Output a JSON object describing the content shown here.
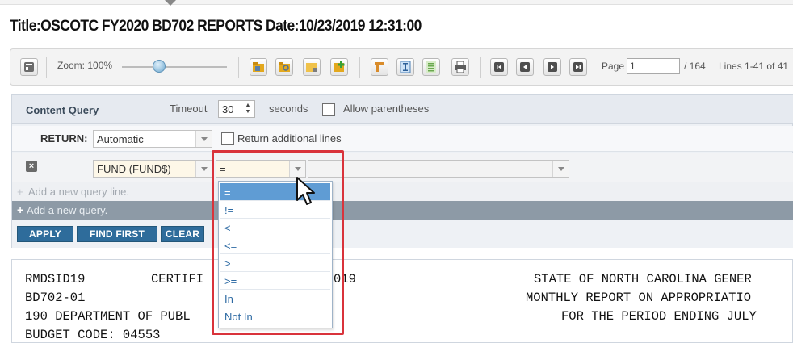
{
  "window": {
    "title": "Title:OSCOTC FY2020 BD702 REPORTS Date:10/23/2019 12:31:00"
  },
  "toolbar": {
    "zoom_label": "Zoom: 100%",
    "zoom_level_percent": 100,
    "page_label": "Page",
    "page_value": "1",
    "page_total": "/ 164",
    "lines_label": "Lines 1-41 of 41",
    "icons": [
      "sidebar-toggle-icon",
      "report-folder-icon",
      "report-folder-search-icon",
      "report-note-icon",
      "report-add-icon",
      "column-icon",
      "text-cursor-icon",
      "document-lines-icon",
      "printer-icon",
      "first-page-icon",
      "previous-page-icon",
      "next-page-icon",
      "last-page-icon"
    ]
  },
  "content_query": {
    "title": "Content Query",
    "timeout_label": "Timeout",
    "timeout_value": "30",
    "seconds_label": "seconds",
    "allow_parentheses_label": "Allow parentheses",
    "return_label": "RETURN:",
    "return_value": "Automatic",
    "return_additional_label": "Return additional lines",
    "field_value": "FUND (FUND$)",
    "operator_value": "=",
    "criteria_value": "",
    "add_line_label": "Add a new query line.",
    "add_query_label": "Add a new query.",
    "buttons": {
      "apply": "APPLY",
      "find_first": "FIND FIRST",
      "clear": "CLEAR"
    },
    "operator_options": [
      "=",
      "!=",
      "<",
      "<=",
      ">",
      ">=",
      "In",
      "Not In"
    ],
    "selected_operator_index": 0
  },
  "report": {
    "lines": [
      {
        "left": "RMDSID19",
        "mid": "CERTIFI",
        "right_mid": "019",
        "right": "STATE OF NORTH CAROLINA GENER"
      },
      {
        "left": "BD702-01",
        "mid": "",
        "right_mid": "",
        "right": "MONTHLY REPORT ON APPROPRIATIO"
      },
      {
        "left": "190 DEPARTMENT OF PUBL",
        "mid": "",
        "right_mid": "",
        "right": "FOR THE PERIOD ENDING JULY"
      },
      {
        "left": "BUDGET CODE: 04553",
        "mid": "",
        "right_mid": "",
        "right": ""
      }
    ]
  },
  "colors": {
    "accent_blue": "#2e6c9b",
    "highlight_red": "#d9333b",
    "dropdown_selected": "#5f9cd4"
  }
}
